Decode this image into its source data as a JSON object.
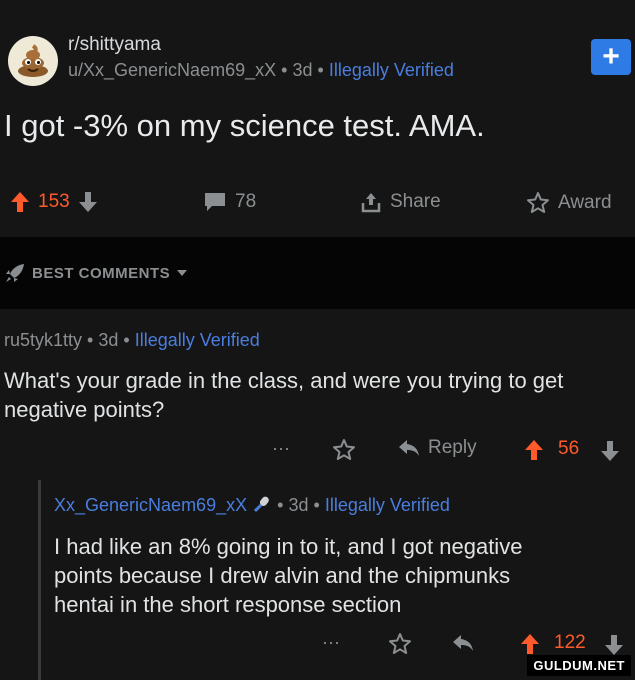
{
  "post": {
    "subreddit": "r/shittyama",
    "author": "u/Xx_GenericNaem69_xX",
    "separator": "•",
    "age": "3d",
    "flair": "Illegally Verified",
    "title": "I got -3% on my science test. AMA.",
    "upvotes": "153",
    "comments": "78",
    "share_label": "Share",
    "award_label": "Award"
  },
  "best_comments": {
    "label": "BEST COMMENTS"
  },
  "comment1": {
    "author": "ru5tyk1tty",
    "separator": "•",
    "age": "3d",
    "flair": "Illegally Verified",
    "text": "What's your grade in the class, and were you trying to get negative points?",
    "more": "···",
    "reply_label": "Reply",
    "votes": "56"
  },
  "comment2": {
    "author": "Xx_GenericNaem69_xX",
    "separator": "•",
    "age": "3d",
    "flair": "Illegally Verified",
    "text": "I had like an 8% going in to it, and I got negative points because I drew alvin and the chipmunks hentai in the short response section",
    "more": "···",
    "votes": "122"
  },
  "watermark": "GULDUM.NET",
  "colors": {
    "upvote": "#ff5a2c",
    "link": "#4a7ede",
    "join": "#2e7be6"
  }
}
